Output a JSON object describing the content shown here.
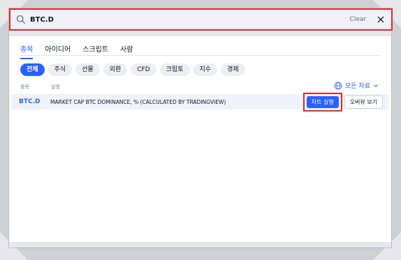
{
  "search": {
    "value": "BTC.D",
    "clear_label": "Clear"
  },
  "tabs": [
    {
      "label": "종목",
      "active": true
    },
    {
      "label": "아이디어",
      "active": false
    },
    {
      "label": "스크립트",
      "active": false
    },
    {
      "label": "사람",
      "active": false
    }
  ],
  "chips": [
    {
      "label": "전체",
      "active": true
    },
    {
      "label": "주식"
    },
    {
      "label": "선물"
    },
    {
      "label": "외환"
    },
    {
      "label": "CFD"
    },
    {
      "label": "크립토"
    },
    {
      "label": "지수"
    },
    {
      "label": "경제"
    }
  ],
  "columns": {
    "symbol": "종목",
    "description": "설명"
  },
  "sources_label": "모든 자료",
  "result": {
    "symbol": "BTC.D",
    "description": "MARKET CAP BTC DOMINANCE, % (CALCULATED BY TRADINGVIEW)",
    "launch_label": "차트 실행",
    "overview_label": "오버뷰 보기"
  },
  "colors": {
    "accent": "#2962ff",
    "highlight": "#e02a2a"
  }
}
